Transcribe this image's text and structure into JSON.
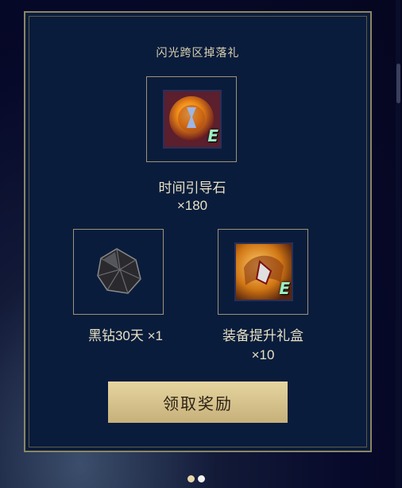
{
  "panel": {
    "title": "闪光跨区掉落礼",
    "items": [
      {
        "name": "时间引导石",
        "qty": "×180",
        "icon": "time-guide-stone-icon"
      },
      {
        "name": "黑钻30天",
        "qty": "×1",
        "icon": "black-diamond-icon"
      },
      {
        "name": "装备提升礼盒",
        "qty": "×10",
        "icon": "equipment-upgrade-box-icon"
      }
    ],
    "claim_button": "领取奖励"
  },
  "badge_letter": "E",
  "carousel": {
    "count": 2,
    "active_index": 0
  }
}
